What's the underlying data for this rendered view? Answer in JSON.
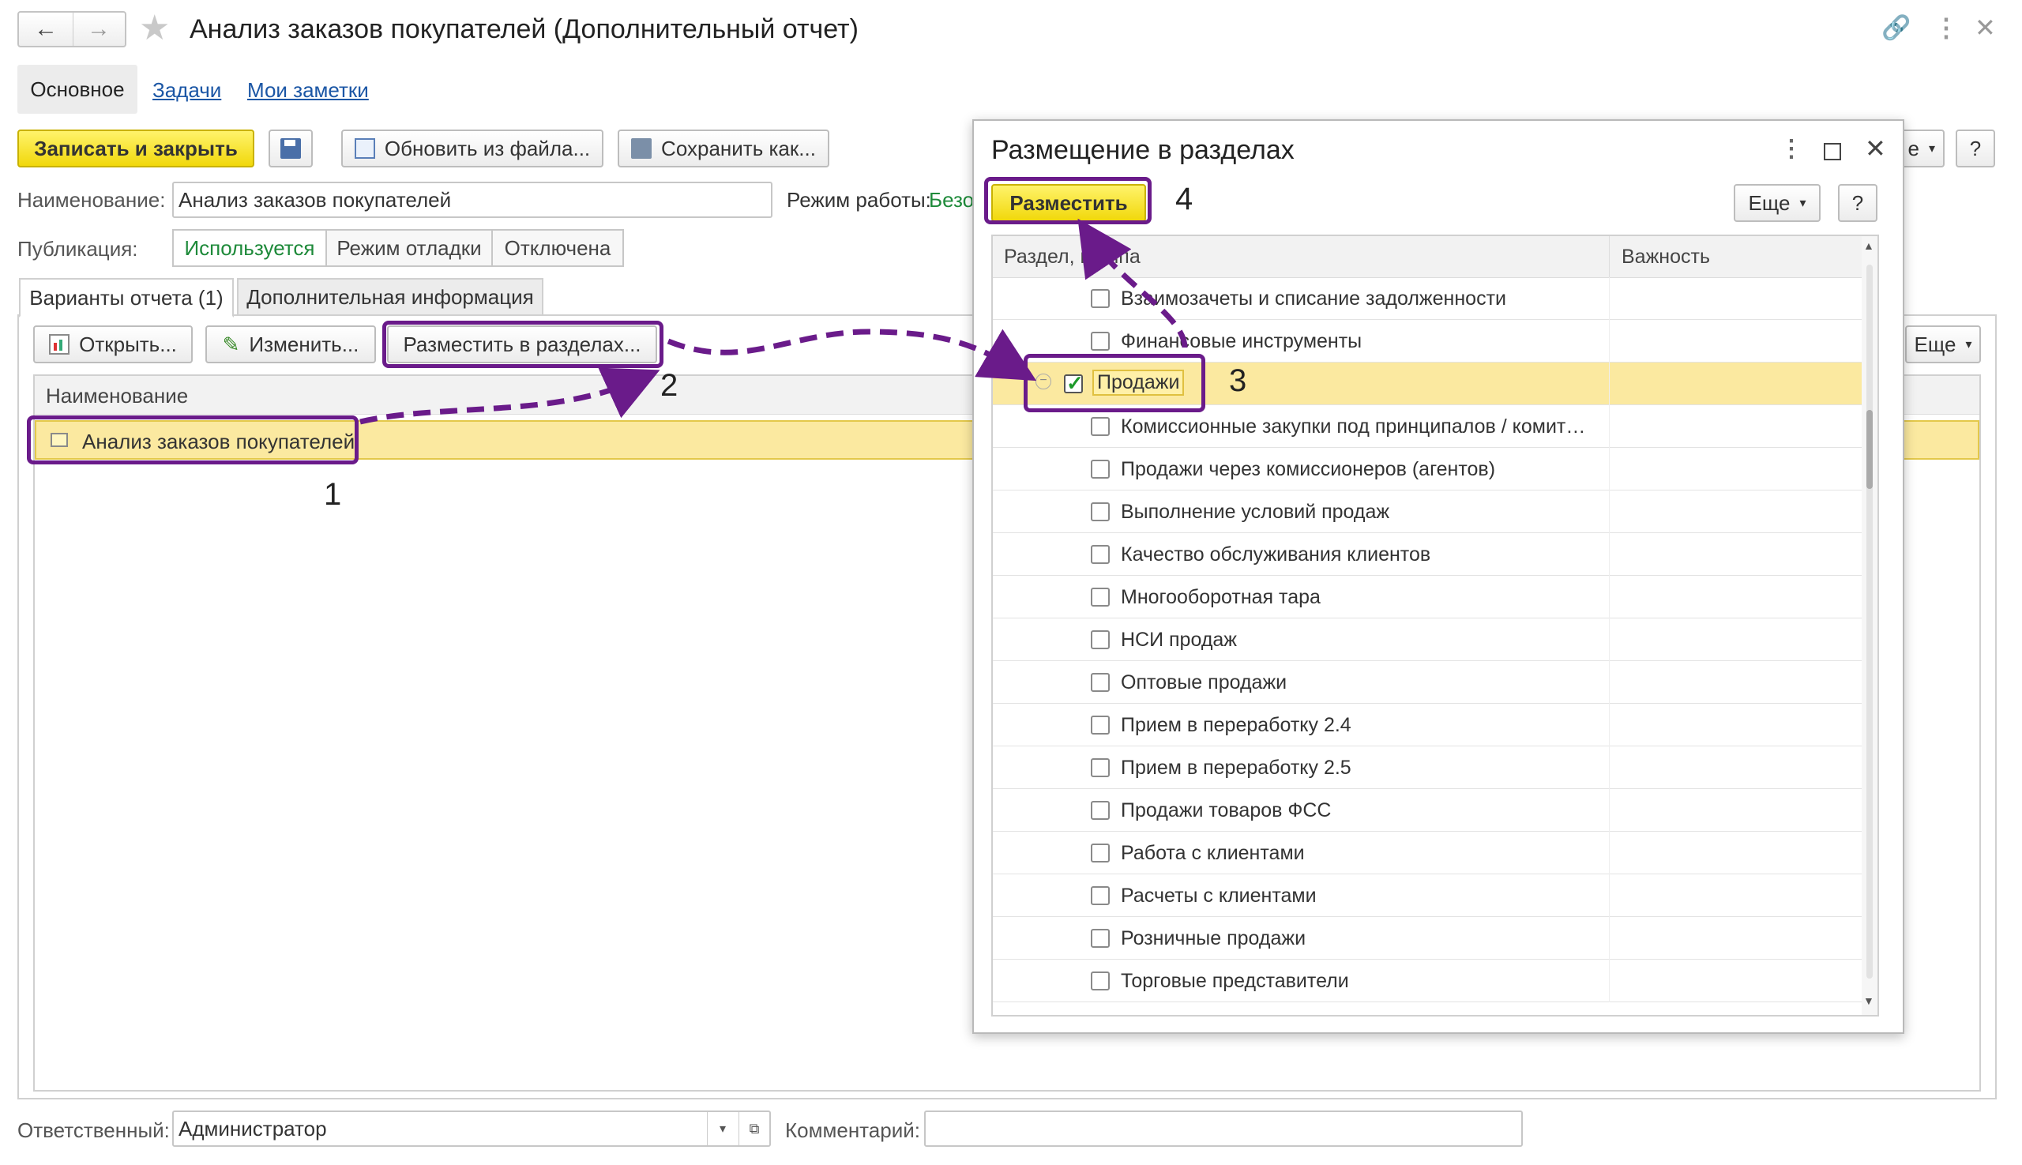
{
  "window": {
    "title": "Анализ заказов покупателей (Дополнительный отчет)",
    "tabs": [
      "Основное",
      "Задачи",
      "Мои заметки"
    ]
  },
  "toolbar": {
    "save_close_label": "Записать и закрыть",
    "update_from_file_label": "Обновить из файла...",
    "save_as_label": "Сохранить как...",
    "more_label_partial": "е",
    "help_label": "?"
  },
  "form": {
    "name_label": "Наименование:",
    "name_value": "Анализ заказов покупателей",
    "mode_label": "Режим работы:",
    "mode_value": "Безо",
    "publication_label": "Публикация:",
    "publication_options": [
      "Используется",
      "Режим отладки",
      "Отключена"
    ]
  },
  "content_tabs": [
    "Варианты отчета (1)",
    "Дополнительная информация"
  ],
  "variants_toolbar": {
    "open_label": "Открыть...",
    "edit_label": "Изменить...",
    "place_label": "Разместить в разделах...",
    "more_label": "Еще"
  },
  "variants_table": {
    "column_header": "Наименование",
    "rows": [
      "Анализ заказов покупателей"
    ]
  },
  "footer": {
    "responsible_label": "Ответственный:",
    "responsible_value": "Администратор",
    "comment_label": "Комментарий:",
    "comment_value": ""
  },
  "dialog": {
    "title": "Размещение в разделах",
    "place_button": "Разместить",
    "more_label": "Еще",
    "help_label": "?",
    "columns": [
      "Раздел, группа",
      "Важность"
    ],
    "rows": [
      {
        "label": "Взаимозачеты и списание задолженности",
        "checked": false,
        "level": 1
      },
      {
        "label": "Финансовые инструменты",
        "checked": false,
        "level": 1
      },
      {
        "label": "Продажи",
        "checked": true,
        "level": 0
      },
      {
        "label": "Комиссионные закупки под принципалов / комит…",
        "checked": false,
        "level": 1
      },
      {
        "label": "Продажи через комиссионеров (агентов)",
        "checked": false,
        "level": 1
      },
      {
        "label": "Выполнение условий продаж",
        "checked": false,
        "level": 1
      },
      {
        "label": "Качество обслуживания клиентов",
        "checked": false,
        "level": 1
      },
      {
        "label": "Многооборотная тара",
        "checked": false,
        "level": 1
      },
      {
        "label": "НСИ продаж",
        "checked": false,
        "level": 1
      },
      {
        "label": "Оптовые продажи",
        "checked": false,
        "level": 1
      },
      {
        "label": "Прием в переработку 2.4",
        "checked": false,
        "level": 1
      },
      {
        "label": "Прием в переработку 2.5",
        "checked": false,
        "level": 1
      },
      {
        "label": "Продажи товаров ФСС",
        "checked": false,
        "level": 1
      },
      {
        "label": "Работа с клиентами",
        "checked": false,
        "level": 1
      },
      {
        "label": "Расчеты с клиентами",
        "checked": false,
        "level": 1
      },
      {
        "label": "Розничные продажи",
        "checked": false,
        "level": 1
      },
      {
        "label": "Торговые представители",
        "checked": false,
        "level": 1
      }
    ]
  },
  "annotations": [
    "1",
    "2",
    "3",
    "4"
  ],
  "colors": {
    "accent_yellow": "#f3dc12",
    "selection_yellow": "#fbe9a0",
    "annotation_purple": "#6a1b8a",
    "link_blue": "#1b56a5",
    "green_text": "#1e8a3a"
  }
}
